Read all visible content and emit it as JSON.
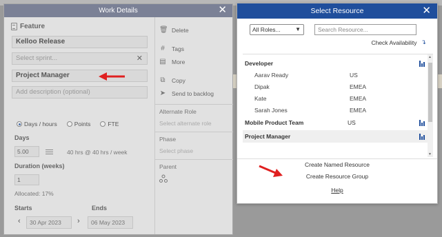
{
  "work_details": {
    "title": "Work Details",
    "feature_label": "Feature",
    "name_value": "Kelloo Release",
    "sprint_placeholder": "Select sprint...",
    "role_value": "Project Manager",
    "description_placeholder": "Add description (optional)",
    "units": [
      "Days / hours",
      "Points",
      "FTE"
    ],
    "selected_unit": "Days / hours",
    "days_label": "Days",
    "days_value": "5.00",
    "hours_text": "40 hrs @ 40 hrs / week",
    "duration_label": "Duration (weeks)",
    "duration_value": "1",
    "allocated_text": "Allocated: 17%",
    "starts_label": "Starts",
    "ends_label": "Ends",
    "start_date": "30 Apr 2023",
    "end_date": "06 May 2023",
    "actions": {
      "delete": "Delete",
      "tags": "Tags",
      "more": "More",
      "copy": "Copy",
      "send_to_backlog": "Send to backlog"
    },
    "alternate_role_label": "Alternate Role",
    "alternate_role_placeholder": "Select alternate role",
    "phase_label": "Phase",
    "phase_placeholder": "Select phase",
    "parent_label": "Parent"
  },
  "select_resource": {
    "title": "Select Resource",
    "roles_filter": "All Roles...",
    "search_placeholder": "Search Resource...",
    "check_availability": "Check Availability",
    "rows": [
      {
        "type": "group",
        "name": "Developer",
        "location": "",
        "chart": true
      },
      {
        "type": "member",
        "name": "Aarav Ready",
        "location": "US"
      },
      {
        "type": "member",
        "name": "Dipak",
        "location": "EMEA"
      },
      {
        "type": "member",
        "name": "Kate",
        "location": "EMEA"
      },
      {
        "type": "member",
        "name": "Sarah Jones",
        "location": "EMEA"
      },
      {
        "type": "group",
        "name": "Mobile Product Team",
        "location": "US",
        "chart": true
      },
      {
        "type": "group",
        "name": "Project Manager",
        "location": "",
        "chart": true,
        "highlighted": true
      }
    ],
    "create_named": "Create Named Resource",
    "create_group": "Create Resource Group",
    "help": "Help"
  },
  "colors": {
    "accent": "#1f4e9c",
    "annotation_arrow": "#e02020",
    "dimmed_header": "#7b8196"
  }
}
